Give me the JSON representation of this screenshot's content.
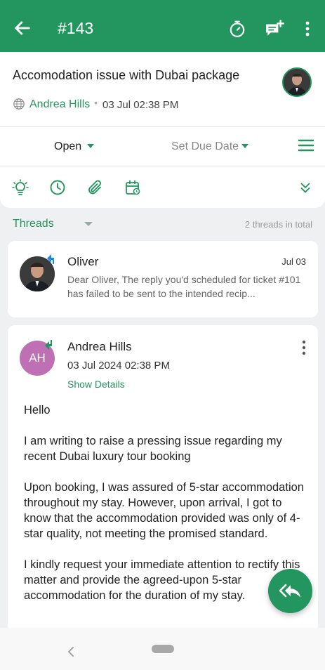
{
  "appbar": {
    "ticket_number": "#143",
    "icons": [
      "back-arrow-icon",
      "timer-icon",
      "add-note-icon",
      "more-vertical-icon"
    ]
  },
  "ticket": {
    "subject": "Accomodation issue with Dubai package",
    "requester": "Andrea Hills",
    "created": "03 Jul 02:38 PM",
    "status": "Open",
    "due_date_label": "Set Due Date"
  },
  "toolbar": {
    "icons": [
      "lightbulb-icon",
      "clock-icon",
      "paperclip-icon",
      "calendar-icon",
      "double-chevron-down-icon"
    ]
  },
  "threads": {
    "label": "Threads",
    "count_text": "2 threads in total",
    "items": [
      {
        "name": "Oliver",
        "date": "Jul 03",
        "preview": "Dear Oliver, The reply you'd scheduled for ticket #101 has failed to be sent to the intended recip..."
      }
    ]
  },
  "message": {
    "initials": "AH",
    "name": "Andrea Hills",
    "datetime": "03 Jul 2024 02:38 PM",
    "show_details": "Show Details",
    "paragraphs": [
      "Hello",
      "I am writing to raise a pressing issue regarding my recent Dubai luxury tour booking",
      "Upon booking, I was assured of 5-star accommodation throughout my stay. However, upon arrival, I got to know that the accommodation provided was only of 4-star quality, not meeting the promised standard.",
      "I kindly request your immediate attention to rectify this matter and provide the agreed-upon 5-star accommodation for the duration of my stay."
    ]
  },
  "colors": {
    "brand_green": "#23955e",
    "avatar_purple": "#bf6fb4",
    "incoming_arrow": "#1e88e5"
  }
}
